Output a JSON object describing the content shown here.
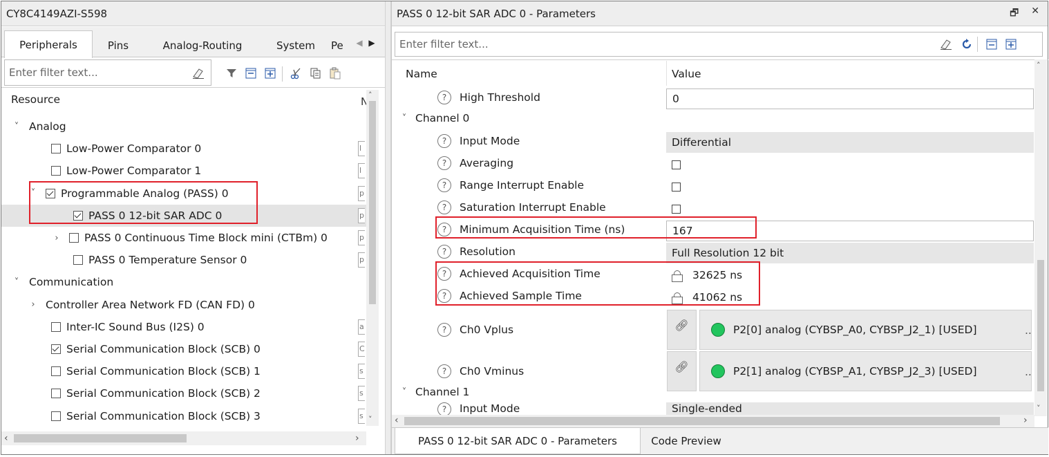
{
  "left_panel": {
    "title": "CY8C4149AZI-S598",
    "tabs": [
      "Peripherals",
      "Pins",
      "Analog-Routing",
      "System",
      "Pe"
    ],
    "filter_placeholder": "Enter filter text...",
    "column_header": "Resource",
    "column_header2": "N",
    "tree": [
      {
        "label": "Analog",
        "chevron": "˅",
        "checkbox": null,
        "indent": 0
      },
      {
        "label": "Low-Power Comparator 0",
        "chevron": "",
        "checkbox": false,
        "indent": 2,
        "stub": "l"
      },
      {
        "label": "Low-Power Comparator 1",
        "chevron": "",
        "checkbox": false,
        "indent": 2,
        "stub": "l"
      },
      {
        "label": "Programmable Analog (PASS) 0",
        "chevron": "˅",
        "checkbox": true,
        "indent": 1,
        "stub": "p"
      },
      {
        "label": "PASS 0 12-bit SAR ADC 0",
        "chevron": "",
        "checkbox": true,
        "indent": 3,
        "stub": "p",
        "selected": true
      },
      {
        "label": "PASS 0 Continuous Time Block mini (CTBm) 0",
        "chevron": "›",
        "checkbox": false,
        "indent": 2,
        "stub": "p"
      },
      {
        "label": "PASS 0 Temperature Sensor 0",
        "chevron": "",
        "checkbox": false,
        "indent": 3,
        "stub": "p"
      },
      {
        "label": "Communication",
        "chevron": "˅",
        "checkbox": null,
        "indent": 0
      },
      {
        "label": "Controller Area Network FD (CAN FD) 0",
        "chevron": "›",
        "checkbox": null,
        "indent": 1
      },
      {
        "label": "Inter-IC Sound Bus (I2S) 0",
        "chevron": "",
        "checkbox": false,
        "indent": 2,
        "stub": "a"
      },
      {
        "label": "Serial Communication Block (SCB) 0",
        "chevron": "",
        "checkbox": true,
        "indent": 2,
        "stub": "C"
      },
      {
        "label": "Serial Communication Block (SCB) 1",
        "chevron": "",
        "checkbox": false,
        "indent": 2,
        "stub": "s"
      },
      {
        "label": "Serial Communication Block (SCB) 2",
        "chevron": "",
        "checkbox": false,
        "indent": 2,
        "stub": "s"
      },
      {
        "label": "Serial Communication Block (SCB) 3",
        "chevron": "",
        "checkbox": false,
        "indent": 2,
        "stub": "s"
      }
    ]
  },
  "right_panel": {
    "title": "PASS 0 12-bit SAR ADC 0 - Parameters",
    "filter_placeholder": "Enter filter text...",
    "header_name": "Name",
    "header_value": "Value",
    "rows": [
      {
        "kind": "param",
        "name": "High Threshold",
        "value": "0",
        "style": "white"
      },
      {
        "kind": "group",
        "name": "Channel 0"
      },
      {
        "kind": "param",
        "name": "Input Mode",
        "value": "Differential",
        "style": "gray"
      },
      {
        "kind": "param",
        "name": "Averaging",
        "value": "",
        "style": "checkbox"
      },
      {
        "kind": "param",
        "name": "Range Interrupt Enable",
        "value": "",
        "style": "checkbox"
      },
      {
        "kind": "param",
        "name": "Saturation Interrupt Enable",
        "value": "",
        "style": "checkbox"
      },
      {
        "kind": "param",
        "name": "Minimum Acquisition Time (ns)",
        "value": "167",
        "style": "white"
      },
      {
        "kind": "param",
        "name": "Resolution",
        "value": "Full Resolution 12 bit",
        "style": "gray"
      },
      {
        "kind": "param",
        "name": "Achieved Acquisition Time",
        "value": "32625 ns",
        "style": "locked"
      },
      {
        "kind": "param",
        "name": "Achieved Sample Time",
        "value": "41062 ns",
        "style": "locked"
      }
    ],
    "pin_rows": [
      {
        "name": "Ch0 Vplus",
        "value": "P2[0] analog (CYBSP_A0, CYBSP_J2_1) [USED]"
      },
      {
        "name": "Ch0 Vminus",
        "value": "P2[1] analog (CYBSP_A1, CYBSP_J2_3) [USED]"
      }
    ],
    "channel1": {
      "name": "Channel 1",
      "input_mode_name": "Input Mode",
      "input_mode_value": "Single-ended"
    },
    "bottom_tabs": [
      "PASS 0 12-bit SAR ADC 0 - Parameters",
      "Code Preview"
    ],
    "more": "..",
    "window_controls": {
      "restore": "🗗",
      "close": "✕"
    }
  }
}
